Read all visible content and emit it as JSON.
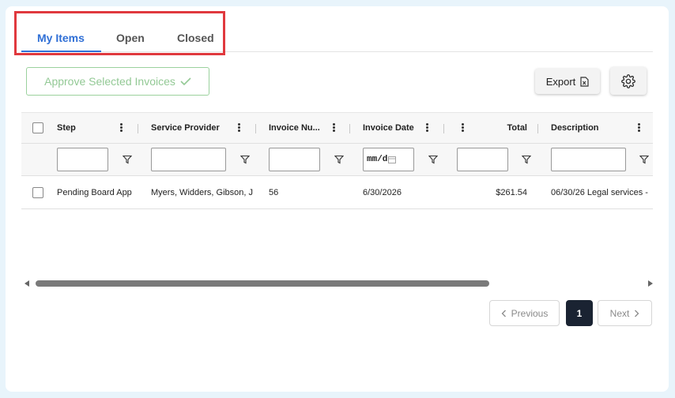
{
  "tabs": [
    {
      "label": "My Items",
      "active": true
    },
    {
      "label": "Open",
      "active": false
    },
    {
      "label": "Closed",
      "active": false
    }
  ],
  "toolbar": {
    "approve_label": "Approve Selected Invoices",
    "export_label": "Export"
  },
  "table": {
    "columns": [
      {
        "label": "Step"
      },
      {
        "label": "Service Provider"
      },
      {
        "label": "Invoice Nu..."
      },
      {
        "label": "Invoice Date"
      },
      {
        "label": ""
      },
      {
        "label": "Total"
      },
      {
        "label": "Description"
      }
    ],
    "filters": {
      "date_placeholder": "mm/d"
    },
    "rows": [
      {
        "step": "Pending Board App",
        "provider": "Myers, Widders, Gibson, J",
        "invoice_number": "56",
        "invoice_date": "6/30/2026",
        "total": "$261.54",
        "description": "06/30/26 Legal services -"
      }
    ]
  },
  "pagination": {
    "previous_label": "Previous",
    "current_page": "1",
    "next_label": "Next"
  },
  "colors": {
    "accent": "#2f6fd6",
    "highlight": "#e0393e",
    "approve_green": "#93c995",
    "page_active": "#1a2332"
  }
}
